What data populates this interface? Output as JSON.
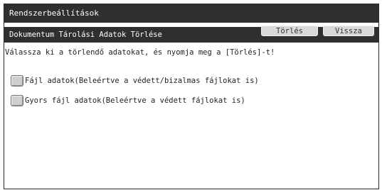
{
  "window": {
    "title": "Rendszerbeállítások"
  },
  "subheader": {
    "title": "Dokumentum Tárolási Adatok Törlése",
    "delete_label": "Törlés",
    "back_label": "Vissza"
  },
  "main": {
    "instruction": "Válassza ki a törlendő adatokat, és nyomja meg a [Törlés]-t!",
    "options": [
      {
        "label": "Fájl adatok(Beleértve a védett/bizalmas fájlokat is)",
        "checked": false
      },
      {
        "label": "Gyors fájl adatok(Beleértve a védett fájlokat is)",
        "checked": false
      }
    ]
  }
}
